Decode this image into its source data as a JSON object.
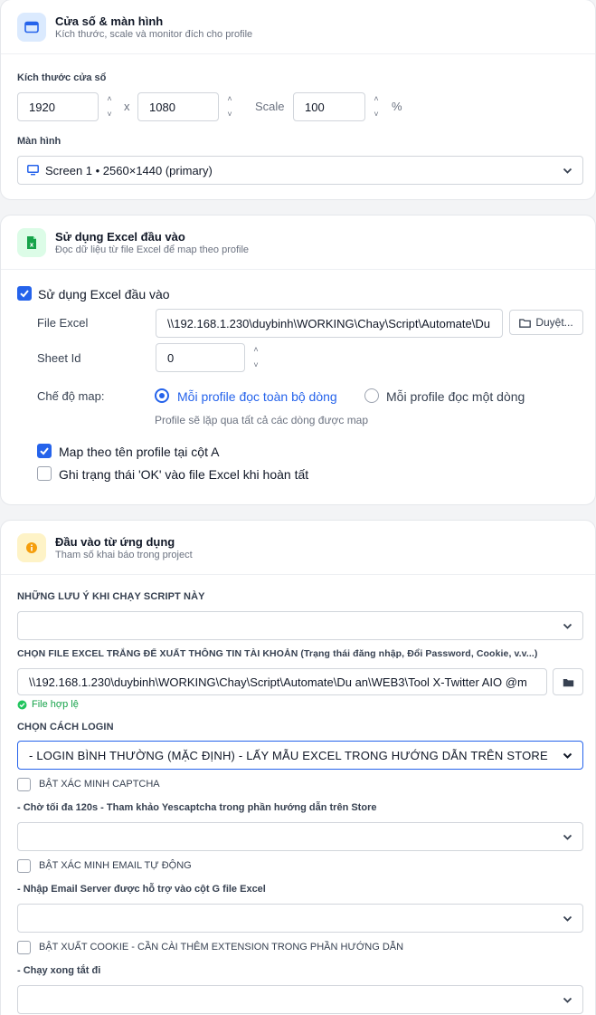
{
  "window_card": {
    "title": "Cửa số & màn hình",
    "subtitle": "Kích thước, scale và monitor đích cho profile",
    "size_label": "Kích thước cửa sổ",
    "width": "1920",
    "times": "x",
    "height": "1080",
    "scale_label": "Scale",
    "scale_value": "100",
    "percent": "%",
    "monitor_label": "Màn hình",
    "monitor_value": "Screen 1 • 2560×1440 (primary)"
  },
  "excel_card": {
    "title": "Sử dụng Excel đầu vào",
    "subtitle": "Đọc dữ liệu từ file Excel để map theo profile",
    "use_excel_label": "Sử dụng Excel đầu vào",
    "file_label": "File Excel",
    "file_value": "\\\\192.168.1.230\\duybinh\\WORKING\\Chay\\Script\\Automate\\Du",
    "browse_label": "Duyệt...",
    "sheet_label": "Sheet Id",
    "sheet_value": "0",
    "map_mode_label": "Chế độ map:",
    "radio_all": "Mỗi profile đọc toàn bộ dòng",
    "radio_one": "Mỗi profile đọc một dòng",
    "radio_hint": "Profile sẽ lặp qua tất cả các dòng được map",
    "map_by_name": "Map theo tên profile tại cột A",
    "write_ok": "Ghi trạng thái 'OK' vào file Excel khi hoàn tất"
  },
  "app_card": {
    "title": "Đầu vào từ ứng dụng",
    "subtitle": "Tham số khai báo trong project",
    "notes_label": "NHỮNG LƯU Ý KHI CHẠY SCRIPT NÀY",
    "notes_value": "",
    "file_label": "CHỌN FILE EXCEL TRẮNG ĐỂ XUẤT THÔNG TIN TÀI KHOẢN (Trạng thái đăng nhập, Đổi Password, Cookie, v.v...)",
    "file_value": "\\\\192.168.1.230\\duybinh\\WORKING\\Chay\\Script\\Automate\\Du an\\WEB3\\Tool X-Twitter AIO @m",
    "file_valid": "File hợp lệ",
    "login_label": "CHỌN CÁCH LOGIN",
    "login_value": "- LOGIN BÌNH THƯỜNG (MẶC ĐỊNH) - LẤY MẪU EXCEL TRONG HƯỚNG DẪN TRÊN STORE",
    "captcha_label": "BẬT XÁC MINH CAPTCHA",
    "captcha_hint": "- Chờ tối đa 120s - Tham khảo Yescaptcha trong phần hướng dẫn trên Store",
    "captcha_value": "",
    "email_label": "BẬT XÁC MINH EMAIL TỰ ĐỘNG",
    "email_hint": "- Nhập Email Server được hỗ trợ vào cột G file Excel",
    "email_value": "",
    "cookie_label": "BẬT XUẤT COOKIE - CẦN CÀI THÊM EXTENSION TRONG PHẦN HƯỚNG DẪN",
    "cookie_hint": "- Chạy xong tắt đi",
    "cookie_value": ""
  },
  "colors": {
    "accent": "#2563eb",
    "excel_green": "#16a34a",
    "info_orange": "#f59e0b",
    "valid_green": "#22c55e"
  }
}
